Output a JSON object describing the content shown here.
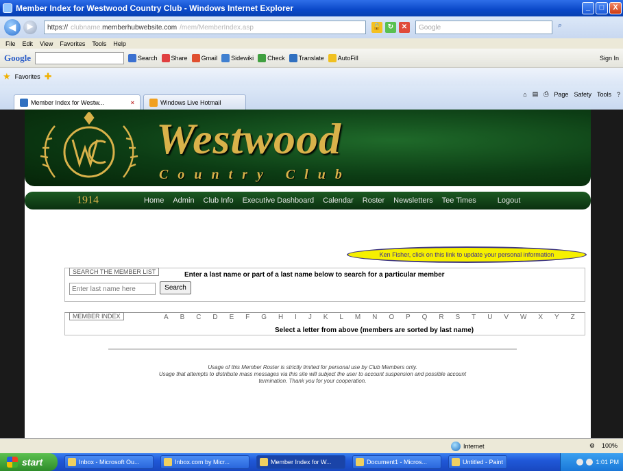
{
  "window": {
    "title": "Member Index for Westwood Country Club - Windows Internet Explorer",
    "min": "_",
    "max": "□",
    "close": "X"
  },
  "addressbar": {
    "url_prefix": "https://",
    "url_domain": "memberhubwebsite.com",
    "url_blur_left": "clubname.",
    "url_blur_right": "/mem/MemberIndex.asp",
    "search_placeholder": "Google",
    "back_icon": "back-arrow-icon",
    "forward_icon": "forward-arrow-icon"
  },
  "menubar": {
    "items": [
      "File",
      "Edit",
      "View",
      "Favorites",
      "Tools",
      "Help"
    ]
  },
  "googlebar": {
    "logo": "Google",
    "items": [
      "Search",
      "Share",
      "Gmail",
      "Sidewiki",
      "Check",
      "Translate",
      "AutoFill"
    ],
    "right": "Sign In"
  },
  "favbar": {
    "label": "Favorites"
  },
  "tabs": [
    {
      "label": "Member Index for Westw..."
    },
    {
      "label": "Windows Live Hotmail"
    }
  ],
  "commandbar": {
    "items": [
      "Page",
      "Safety",
      "Tools"
    ]
  },
  "site": {
    "brand_title": "Westwood",
    "brand_sub": "Country Club",
    "year": "1914",
    "nav": [
      "Home",
      "Admin",
      "Club Info",
      "Executive Dashboard",
      "Calendar",
      "Roster",
      "Newsletters",
      "Tee Times",
      "Logout"
    ],
    "notice": "Ken Fisher, click on this link to update your personal information"
  },
  "search": {
    "legend": "SEARCH THE MEMBER LIST",
    "instruction": "Enter a last name or part of a last name below to search for a particular member",
    "input_placeholder": "Enter last name here",
    "button": "Search"
  },
  "index": {
    "legend": "MEMBER INDEX",
    "letters": [
      "A",
      "B",
      "C",
      "D",
      "E",
      "F",
      "G",
      "H",
      "I",
      "J",
      "K",
      "L",
      "M",
      "N",
      "O",
      "P",
      "Q",
      "R",
      "S",
      "T",
      "U",
      "V",
      "W",
      "X",
      "Y",
      "Z"
    ],
    "instruction": "Select a letter from above (members are sorted by last name)"
  },
  "disclaimer": {
    "line1": "Usage of this Member Roster is strictly limited for personal use by Club Members only.",
    "line2": "Usage that attempts to distribute mass messages via this site will subject the user to account suspension and possible account",
    "line3": "termination. Thank you for your cooperation."
  },
  "statusbar": {
    "zone": "Internet",
    "zoom": "100%"
  },
  "taskbar": {
    "start": "start",
    "tasks": [
      "Inbox - Microsoft Ou...",
      "Inbox.com by Micr...",
      "Member Index for W...",
      "Document1 - Micros...",
      "Untitled - Paint"
    ],
    "clock": "1:01 PM"
  }
}
